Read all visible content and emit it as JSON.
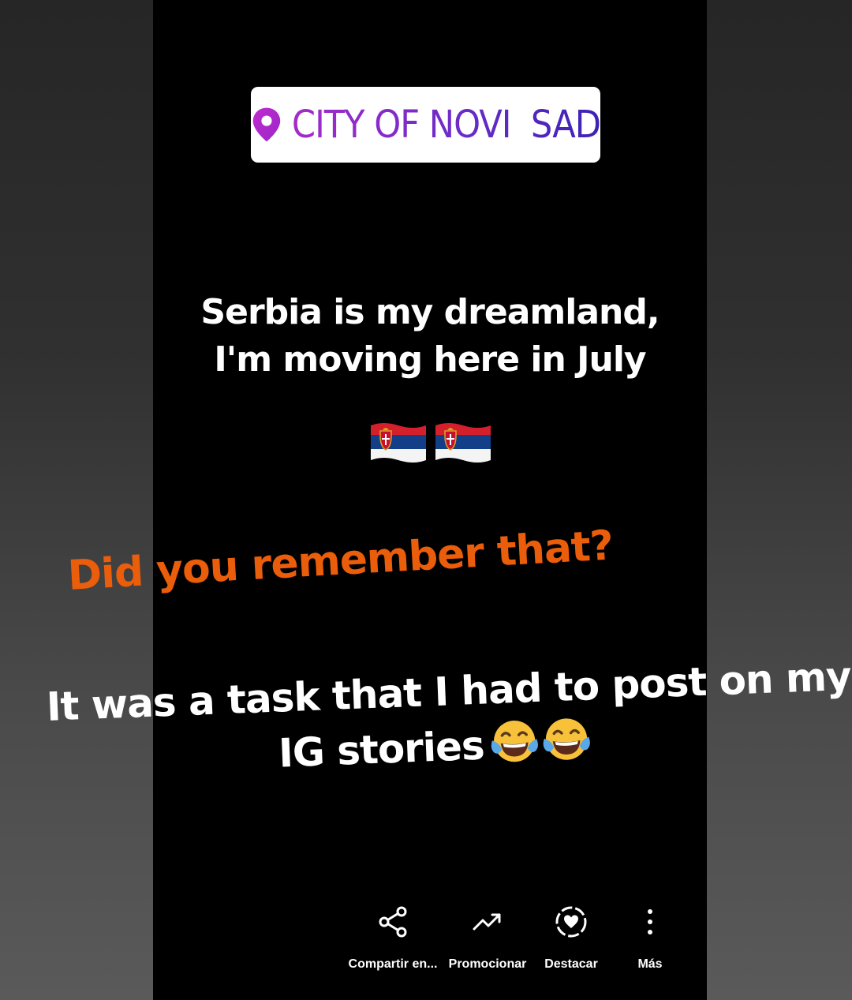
{
  "story": {
    "location_sticker": {
      "icon": "location-pin-icon",
      "text": "CITY OF NOVI  SAD"
    },
    "headline": {
      "line1": "Serbia is my dreamland,",
      "line2": "I'm moving here in July"
    },
    "flags": [
      "serbia-flag-icon",
      "serbia-flag-icon"
    ],
    "orange_caption": "Did you remember that?",
    "task_caption": {
      "line1": "It was a task that I had to post on my",
      "line2": "IG stories"
    },
    "emojis": [
      "tears-of-joy-emoji",
      "tears-of-joy-emoji"
    ],
    "colors": {
      "location_gradient": [
        "#a62ac9",
        "#3d22b5"
      ],
      "orange": "#ea5d0b"
    }
  },
  "actions": [
    {
      "icon": "share-icon",
      "label": "Compartir en..."
    },
    {
      "icon": "trending-up-icon",
      "label": "Promocionar"
    },
    {
      "icon": "highlight-heart-icon",
      "label": "Destacar"
    },
    {
      "icon": "more-vertical-icon",
      "label": "Más"
    }
  ]
}
